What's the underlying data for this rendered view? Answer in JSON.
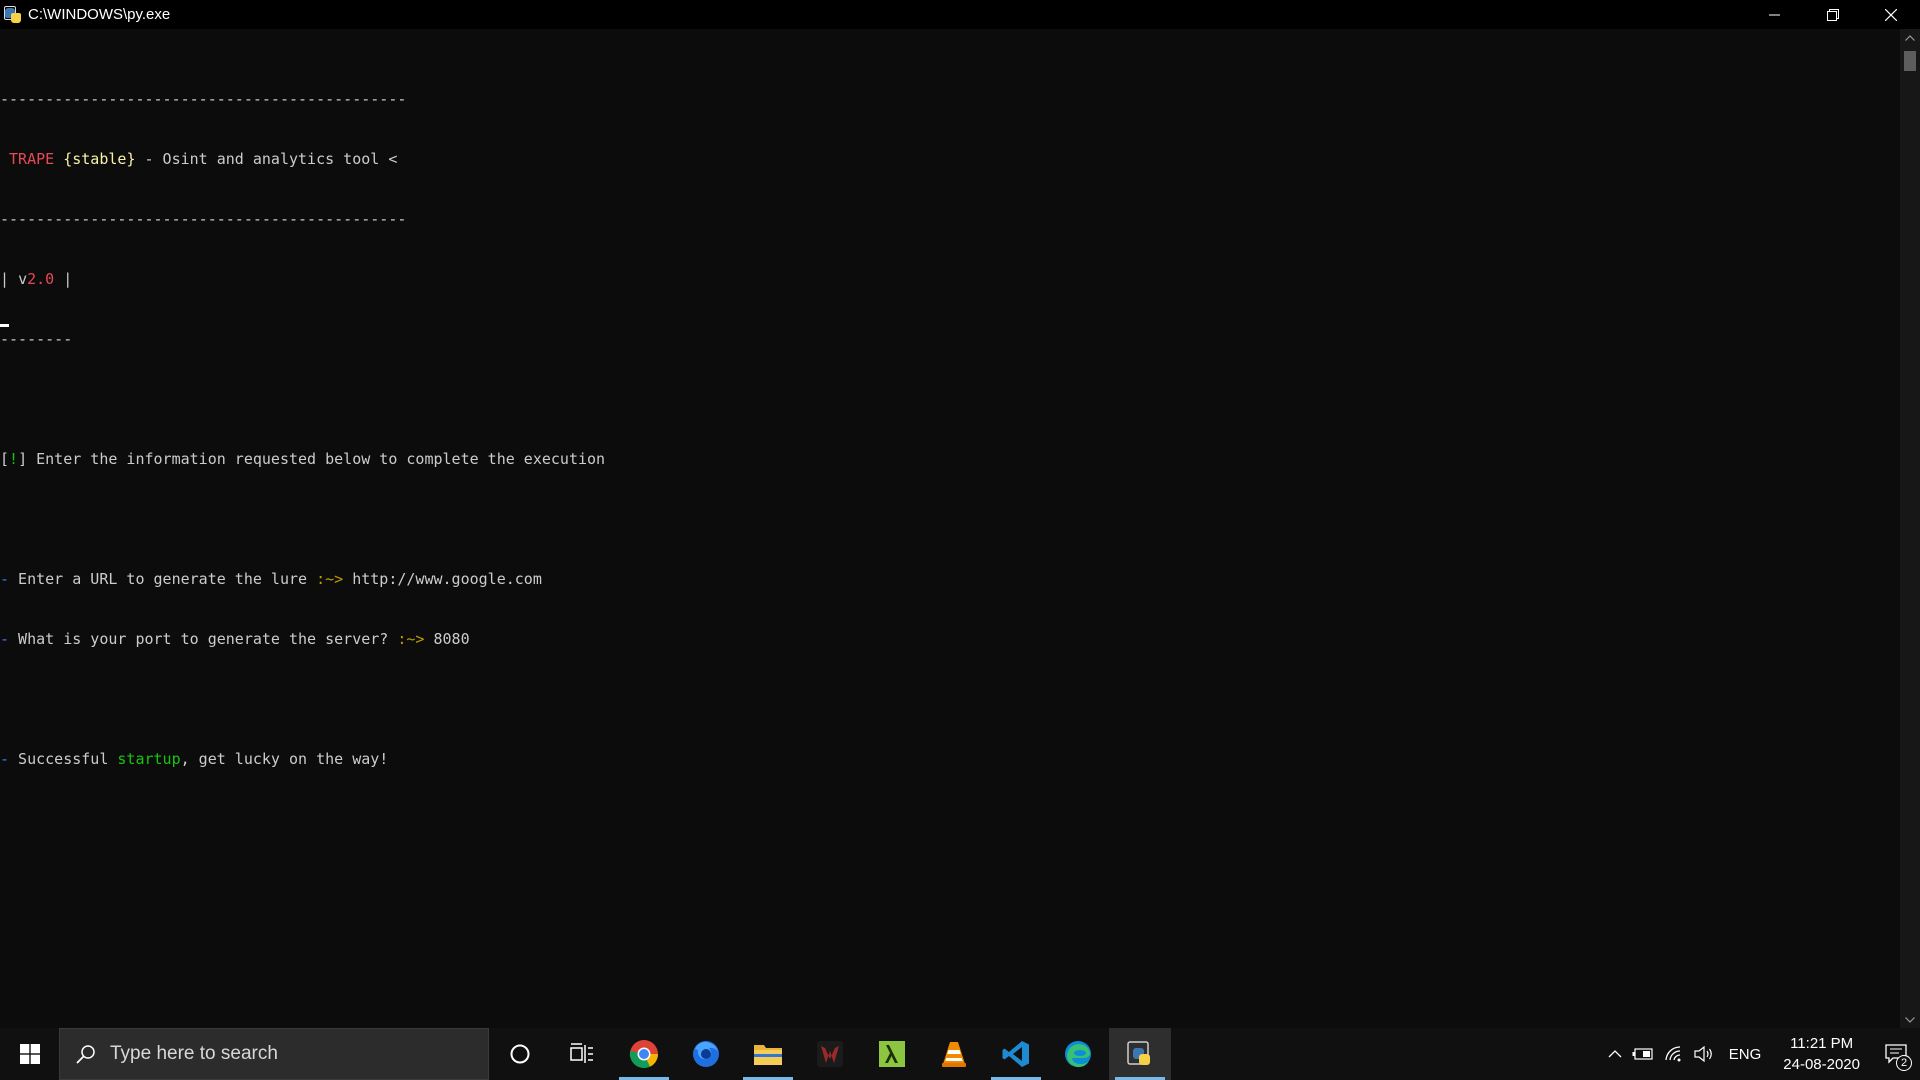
{
  "window": {
    "title": "C:\\WINDOWS\\py.exe",
    "controls": {
      "minimize": "minimize",
      "restore": "restore",
      "close": "close"
    }
  },
  "console": {
    "separator_long": "---------------------------------------------",
    "banner": {
      "name": "TRAPE",
      "brace_open": "{",
      "tag": "stable",
      "brace_close": "}",
      "subtitle": " - Osint and analytics tool <"
    },
    "version": {
      "pipe_open": "| ",
      "v": "v",
      "number": "2.0",
      "pipe_close": " |"
    },
    "separator_short": "--------",
    "notice": {
      "bracket_open": "[",
      "mark": "!",
      "bracket_close": "]",
      "text": " Enter the information requested below to complete the execution"
    },
    "prompts": [
      {
        "bullet": "-",
        "question": " Enter a URL to generate the lure ",
        "arrow": ":~>",
        "answer": " http://www.google.com"
      },
      {
        "bullet": "-",
        "question": " What is your port to generate the server? ",
        "arrow": ":~>",
        "answer": " 8080"
      }
    ],
    "status": {
      "bullet": "-",
      "before": " Successful ",
      "highlight": "startup",
      "after": ", get lucky on the way!"
    }
  },
  "taskbar": {
    "search_placeholder": "Type here to search",
    "apps": [
      "chrome-icon",
      "firefox-icon",
      "file-explorer-icon",
      "predator-icon",
      "lambda-app-icon",
      "vlc-icon",
      "vscode-icon",
      "edge-icon",
      "python-icon"
    ],
    "tray": {
      "language": "ENG",
      "time": "11:21 PM",
      "date": "24-08-2020",
      "notification_count": "2"
    }
  }
}
